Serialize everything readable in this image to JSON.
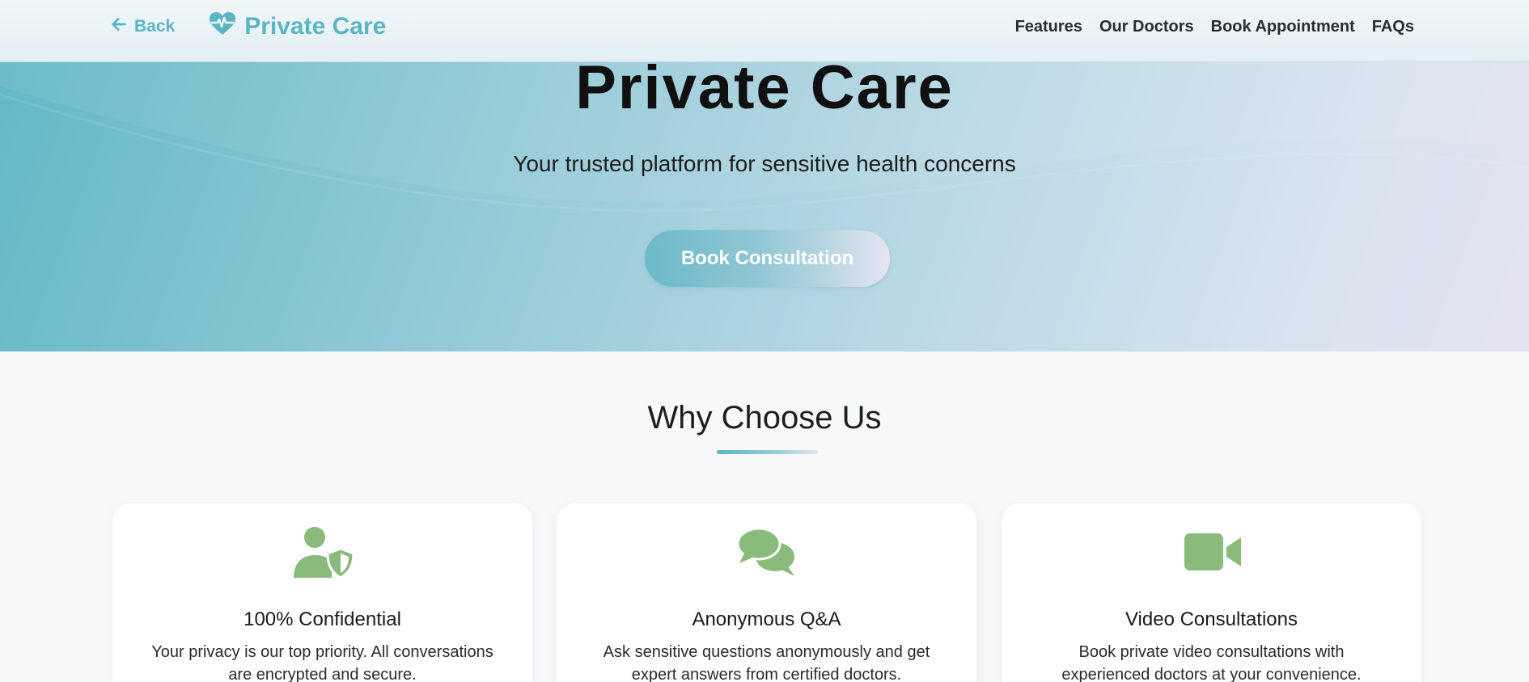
{
  "nav": {
    "back_label": "Back",
    "brand_name": "Private Care",
    "links": [
      "Features",
      "Our Doctors",
      "Book Appointment",
      "FAQs"
    ]
  },
  "hero": {
    "title": "Private Care",
    "subtitle": "Your trusted platform for sensitive health concerns",
    "cta_label": "Book Consultation"
  },
  "why": {
    "title": "Why Choose Us",
    "features": [
      {
        "icon": "user-shield-icon",
        "title": "100% Confidential",
        "description": "Your privacy is our top priority. All conversations are encrypted and secure."
      },
      {
        "icon": "comments-icon",
        "title": "Anonymous Q&A",
        "description": "Ask sensitive questions anonymously and get expert answers from certified doctors."
      },
      {
        "icon": "video-icon",
        "title": "Video Consultations",
        "description": "Book private video consultations with experienced doctors at your convenience."
      }
    ]
  },
  "colors": {
    "accent": "#5bb5c4",
    "icon_green": "#8bbb7a",
    "text_dark": "#1a1a1a",
    "page_bg": "#f7f8fa"
  }
}
